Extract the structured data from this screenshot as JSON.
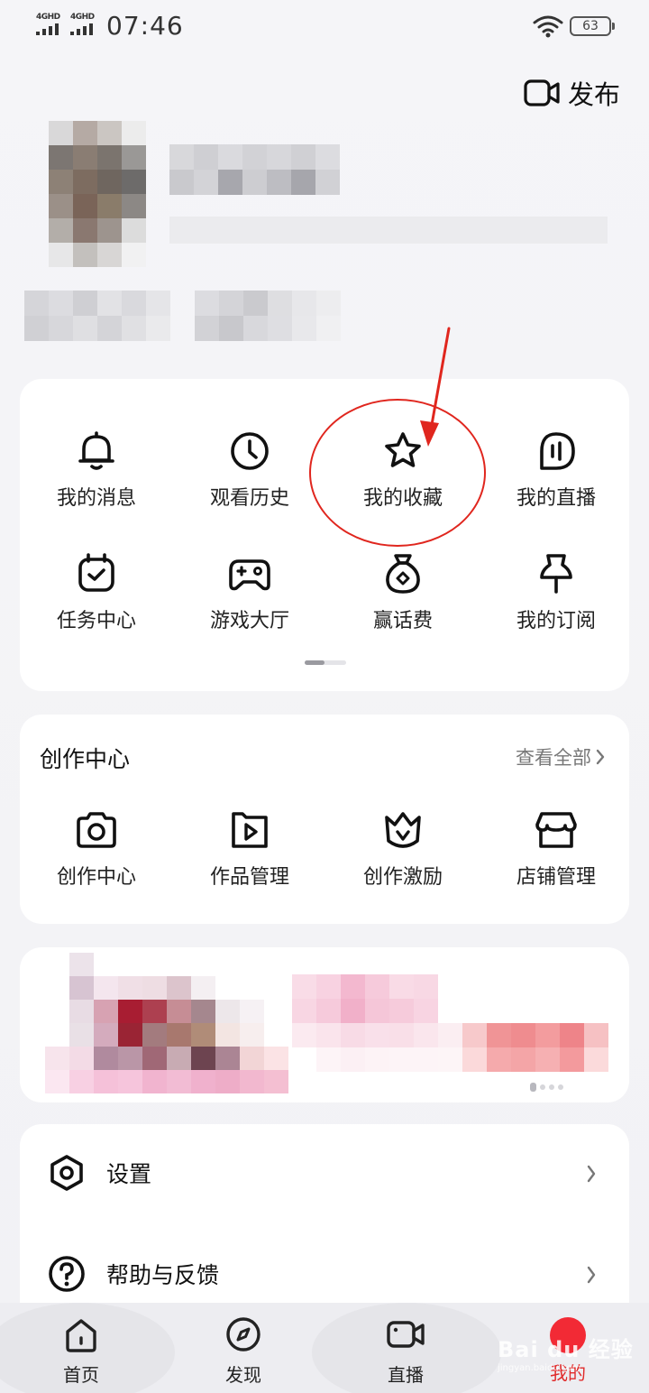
{
  "status_bar": {
    "network_1": "4GHD",
    "network_2": "4GHD",
    "time": "07:46",
    "battery": "63"
  },
  "header": {
    "publish_label": "发布"
  },
  "quick_tools": {
    "items": [
      {
        "label": "我的消息",
        "icon": "bell-icon"
      },
      {
        "label": "观看历史",
        "icon": "clock-icon"
      },
      {
        "label": "我的收藏",
        "icon": "star-icon"
      },
      {
        "label": "我的直播",
        "icon": "live-mic-icon"
      },
      {
        "label": "任务中心",
        "icon": "task-calendar-icon"
      },
      {
        "label": "游戏大厅",
        "icon": "gamepad-icon"
      },
      {
        "label": "赢话费",
        "icon": "money-bag-icon"
      },
      {
        "label": "我的订阅",
        "icon": "pin-icon"
      }
    ]
  },
  "creator_center": {
    "title": "创作中心",
    "view_all": "查看全部",
    "items": [
      {
        "label": "创作中心",
        "icon": "camera-icon"
      },
      {
        "label": "作品管理",
        "icon": "video-play-icon"
      },
      {
        "label": "创作激励",
        "icon": "crown-icon"
      },
      {
        "label": "店铺管理",
        "icon": "store-icon"
      }
    ]
  },
  "settings_list": [
    {
      "label": "设置",
      "icon": "settings-icon"
    },
    {
      "label": "帮助与反馈",
      "icon": "help-icon"
    }
  ],
  "bottom_nav": [
    {
      "label": "首页",
      "icon": "home-icon"
    },
    {
      "label": "发现",
      "icon": "compass-icon"
    },
    {
      "label": "直播",
      "icon": "live-camera-icon"
    },
    {
      "label": "我的",
      "icon": "me-avatar-icon"
    }
  ],
  "watermark": {
    "brand": "Bai du 经验",
    "url": "jingyan.baidu.com"
  },
  "colors": {
    "accent_red": "#e0261e",
    "me_active": "#e02a2a"
  }
}
